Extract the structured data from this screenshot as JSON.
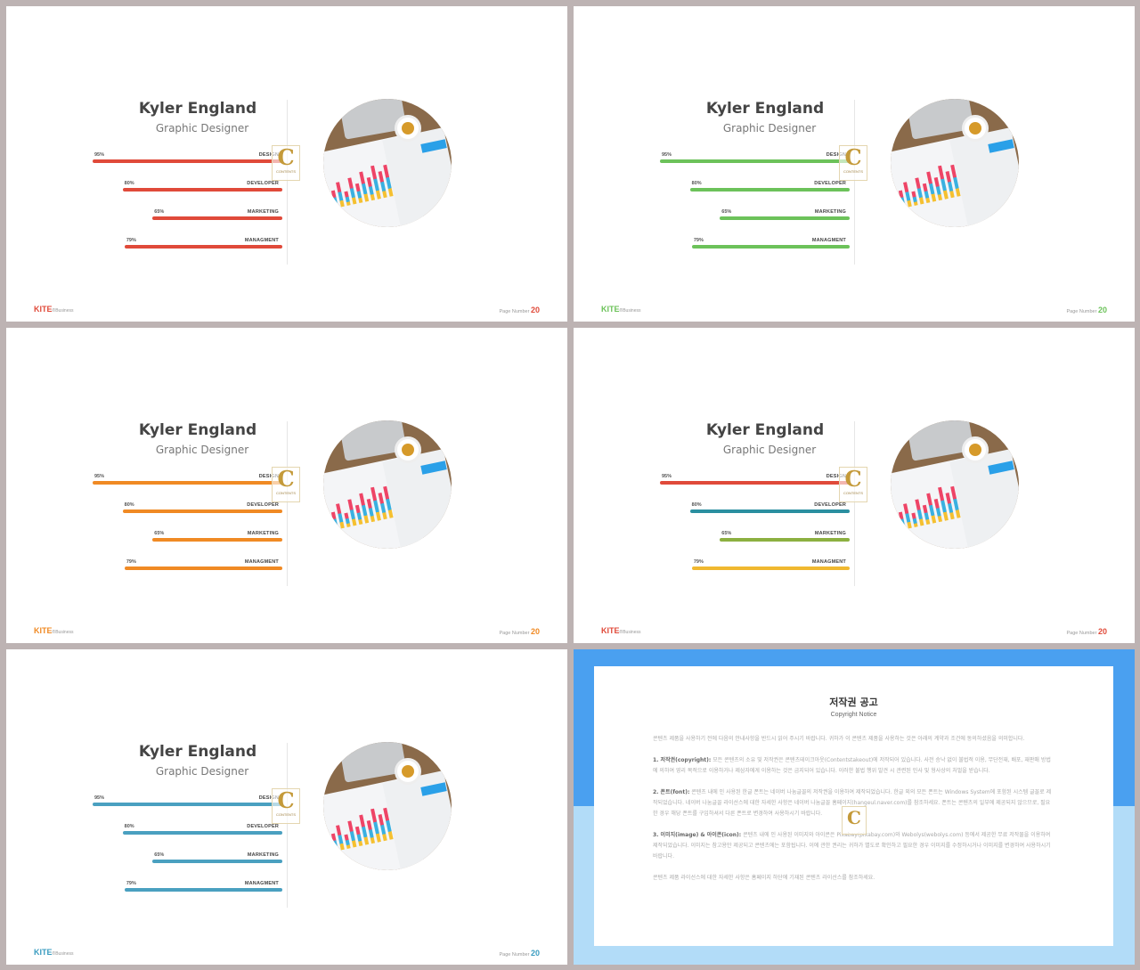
{
  "slides": [
    {
      "name": "Kyler England",
      "role": "Graphic Designer",
      "accent": "#e04a3a",
      "colors": [
        "#e04a3a",
        "#e04a3a",
        "#e04a3a",
        "#e04a3a"
      ],
      "skills": [
        {
          "label": "DESIGN",
          "percent": "95%",
          "value": 95
        },
        {
          "label": "DEVELOPER",
          "percent": "80%",
          "value": 80
        },
        {
          "label": "MARKETING",
          "percent": "65%",
          "value": 65
        },
        {
          "label": "MANAGMENT",
          "percent": "79%",
          "value": 79
        }
      ],
      "brand": "KITE",
      "brand_sub": "®Business",
      "page_label": "Page Number",
      "page_number": "20"
    },
    {
      "name": "Kyler England",
      "role": "Graphic Designer",
      "accent": "#6cc25a",
      "colors": [
        "#6cc25a",
        "#6cc25a",
        "#6cc25a",
        "#6cc25a"
      ],
      "skills": [
        {
          "label": "DESIGN",
          "percent": "95%",
          "value": 95
        },
        {
          "label": "DEVELOPER",
          "percent": "80%",
          "value": 80
        },
        {
          "label": "MARKETING",
          "percent": "65%",
          "value": 65
        },
        {
          "label": "MANAGMENT",
          "percent": "79%",
          "value": 79
        }
      ],
      "brand": "KITE",
      "brand_sub": "®Business",
      "page_label": "Page Number",
      "page_number": "20"
    },
    {
      "name": "Kyler England",
      "role": "Graphic Designer",
      "accent": "#f08a24",
      "colors": [
        "#f08a24",
        "#f08a24",
        "#f08a24",
        "#f08a24"
      ],
      "skills": [
        {
          "label": "DESIGN",
          "percent": "95%",
          "value": 95
        },
        {
          "label": "DEVELOPER",
          "percent": "80%",
          "value": 80
        },
        {
          "label": "MARKETING",
          "percent": "65%",
          "value": 65
        },
        {
          "label": "MANAGMENT",
          "percent": "79%",
          "value": 79
        }
      ],
      "brand": "KITE",
      "brand_sub": "®Business",
      "page_label": "Page Number",
      "page_number": "20"
    },
    {
      "name": "Kyler England",
      "role": "Graphic Designer",
      "accent": "#e04a3a",
      "colors": [
        "#e04a3a",
        "#2a8fa0",
        "#8cb040",
        "#f0b830"
      ],
      "skills": [
        {
          "label": "DESIGN",
          "percent": "95%",
          "value": 95
        },
        {
          "label": "DEVELOPER",
          "percent": "80%",
          "value": 80
        },
        {
          "label": "MARKETING",
          "percent": "65%",
          "value": 65
        },
        {
          "label": "MANAGMENT",
          "percent": "79%",
          "value": 79
        }
      ],
      "brand": "KITE",
      "brand_sub": "®Business",
      "page_label": "Page Number",
      "page_number": "20"
    },
    {
      "name": "Kyler England",
      "role": "Graphic Designer",
      "accent": "#3a9cc0",
      "colors": [
        "#4aa0c0",
        "#4aa0c0",
        "#4aa0c0",
        "#4aa0c0"
      ],
      "skills": [
        {
          "label": "DESIGN",
          "percent": "95%",
          "value": 95
        },
        {
          "label": "DEVELOPER",
          "percent": "80%",
          "value": 80
        },
        {
          "label": "MARKETING",
          "percent": "65%",
          "value": 65
        },
        {
          "label": "MANAGMENT",
          "percent": "79%",
          "value": 79
        }
      ],
      "brand": "KITE",
      "brand_sub": "®Business",
      "page_label": "Page Number",
      "page_number": "20"
    }
  ],
  "watermark": {
    "letter": "C",
    "text": "CONTENTS"
  },
  "notice": {
    "title": "저작권 공고",
    "subtitle": "Copyright Notice",
    "intro": "콘텐츠 제품을 사용하기 전에 다음의 안내사항을 반드시 읽어 주시기 바랍니다. 귀하가 이 콘텐츠 제품을 사용하는 것은 아래의 계약과 조건에 동의하셨음을 의미합니다.",
    "sections": [
      {
        "head": "1. 저작권(copyright):",
        "text": " 모든 콘텐츠의 소유 및 저작권은 콘텐츠테이크아웃(Contentstakeout)에 저작되어 있습니다. 사전 승낙 없이 불법적 이용, 무단전재, 배포, 재판매 방법에 의하여 영리 목적으로 이용하거나 제삼자에게 이용하는 것은 금지되어 있습니다. 이러한 불법 행위 발견 시 관련된 민사 및 형사상의 처벌을 받습니다."
      },
      {
        "head": "2. 폰트(font):",
        "text": " 콘텐츠 내에 인 사용된 한글 폰트는 네이버 나눔글꼴의 저작권을 이용하여 제작되었습니다. 한글 외의 모든 폰트는 Windows System에 포함된 시스템 글꼴로 제작되었습니다. 네이버 나눔글꼴 라이선스에 대한 자세한 사항은 네이버 나눔글꼴 홈페이지(hangeul.naver.com)를 참조하세요. 폰트는 콘텐츠의 일부에 제공되지 않으므로, 필요한 경우 해당 폰트를 구입하셔서 다른 폰트로 변경하여 사용하시기 바랍니다."
      },
      {
        "head": "3. 이미지(image) & 아이콘(icon):",
        "text": " 콘텐츠 내에 인 사용된 이미지와 아이콘은 Pixabay(pixabay.com)와 Webolys(webolys.com) 등에서 제공한 무료 저작물을 이용하여 제작되었습니다. 이미지는 참고용만 제공되고 콘텐츠에는 포함됩니다. 이에 관한 권리는 귀하가 별도로 확인하고 필요한 경우 이미지를 수정하시거나 이미지를 변경하여 사용하시기 바랍니다."
      }
    ],
    "outro": "콘텐츠 제품 라이선스에 대한 자세한 사항은 홈페이지 하단에 기재된 콘텐츠 라이선스를 참조하세요."
  }
}
